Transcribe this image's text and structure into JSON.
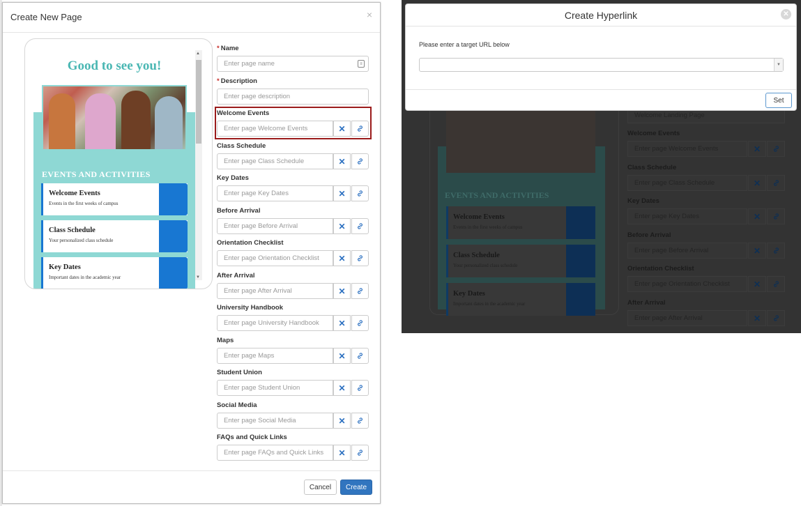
{
  "left_modal": {
    "title": "Create New Page",
    "close_symbol": "×",
    "cancel_label": "Cancel",
    "create_label": "Create"
  },
  "preview": {
    "greeting": "Good to see you!",
    "events_heading": "EVENTS AND ACTIVITIES",
    "cards": [
      {
        "title": "Welcome Events",
        "subtitle": "Events in the first weeks of campus"
      },
      {
        "title": "Class Schedule",
        "subtitle": "Your personalized class schedule"
      },
      {
        "title": "Key Dates",
        "subtitle": "Important dates in the academic year"
      }
    ],
    "accent_color": "#1877d2",
    "teal_color": "#8ed8d4"
  },
  "form": {
    "name": {
      "label": "Name",
      "placeholder": "Enter page name"
    },
    "description": {
      "label": "Description",
      "placeholder": "Enter page description"
    },
    "required_marker": "*",
    "clear_symbol": "✕",
    "fields": [
      {
        "label": "Welcome Events",
        "placeholder": "Enter page Welcome Events"
      },
      {
        "label": "Class Schedule",
        "placeholder": "Enter page Class Schedule"
      },
      {
        "label": "Key Dates",
        "placeholder": "Enter page Key Dates"
      },
      {
        "label": "Before Arrival",
        "placeholder": "Enter page Before Arrival"
      },
      {
        "label": "Orientation Checklist",
        "placeholder": "Enter page Orientation Checklist"
      },
      {
        "label": "After Arrival",
        "placeholder": "Enter page After Arrival"
      },
      {
        "label": "University Handbook",
        "placeholder": "Enter page University Handbook"
      },
      {
        "label": "Maps",
        "placeholder": "Enter page Maps"
      },
      {
        "label": "Student Union",
        "placeholder": "Enter page Student Union"
      },
      {
        "label": "Social Media",
        "placeholder": "Enter page Social Media"
      },
      {
        "label": "FAQs and Quick Links",
        "placeholder": "Enter page FAQs and Quick Links"
      }
    ]
  },
  "hyperlink_dialog": {
    "title": "Create Hyperlink",
    "instruction": "Please enter a target URL below",
    "url_value": "",
    "set_label": "Set",
    "close_symbol": "✕"
  },
  "background": {
    "name_value": "Welcome Landing Page",
    "events_heading": "EVENTS AND ACTIVITIES",
    "cards": [
      {
        "title": "Welcome Events",
        "subtitle": "Events in the first weeks of campus"
      },
      {
        "title": "Class Schedule",
        "subtitle": "Your personalized class schedule"
      },
      {
        "title": "Key Dates",
        "subtitle": "Important dates in the academic year"
      }
    ],
    "fields": [
      {
        "label": "Welcome Events",
        "placeholder": "Enter page Welcome Events"
      },
      {
        "label": "Class Schedule",
        "placeholder": "Enter page Class Schedule"
      },
      {
        "label": "Key Dates",
        "placeholder": "Enter page Key Dates"
      },
      {
        "label": "Before Arrival",
        "placeholder": "Enter page Before Arrival"
      },
      {
        "label": "Orientation Checklist",
        "placeholder": "Enter page Orientation Checklist"
      },
      {
        "label": "After Arrival",
        "placeholder": "Enter page After Arrival"
      }
    ]
  }
}
